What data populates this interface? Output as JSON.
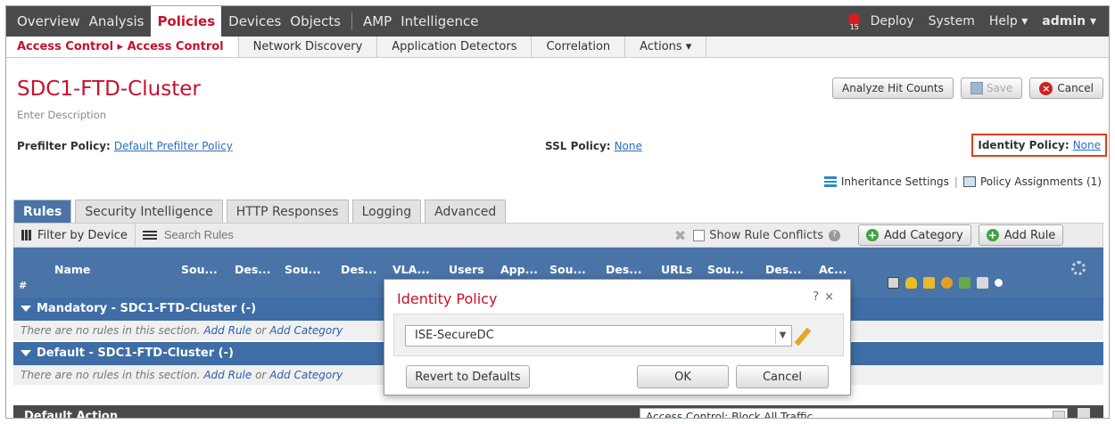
{
  "topnav": {
    "items": [
      "Overview",
      "Analysis",
      "Policies",
      "Devices",
      "Objects",
      "AMP",
      "Intelligence"
    ],
    "active": "Policies",
    "alert_count": "15",
    "right": [
      "Deploy",
      "System",
      "Help ▾",
      "admin ▾"
    ]
  },
  "subnav": {
    "breadcrumb": "Access Control ▸ Access Control",
    "items": [
      "Network Discovery",
      "Application Detectors",
      "Correlation",
      "Actions ▾"
    ]
  },
  "policy": {
    "title": "SDC1-FTD-Cluster",
    "description": "Enter Description",
    "analyze_label": "Analyze Hit Counts",
    "save_label": "Save",
    "cancel_label": "Cancel",
    "prefilter_label": "Prefilter Policy:",
    "prefilter_value": "Default Prefilter Policy",
    "ssl_label": "SSL Policy:",
    "ssl_value": "None",
    "identity_label": "Identity Policy:",
    "identity_value": "None",
    "inheritance_label": "Inheritance Settings",
    "divider": "|",
    "assignments_label": "Policy Assignments (1)"
  },
  "tabs": [
    "Rules",
    "Security Intelligence",
    "HTTP Responses",
    "Logging",
    "Advanced"
  ],
  "toolbar": {
    "filter_device": "Filter by Device",
    "search_placeholder": "Search Rules",
    "show_conflicts": "Show Rule Conflicts",
    "add_category": "Add Category",
    "add_rule": "Add Rule"
  },
  "table": {
    "hash": "#",
    "columns": [
      "Name",
      "Sou...",
      "Des...",
      "Sou...",
      "Des...",
      "VLA...",
      "Users",
      "App...",
      "Sou...",
      "Des...",
      "URLs",
      "Sou...",
      "Des...",
      "Ac..."
    ]
  },
  "sections": [
    {
      "label": "Mandatory - SDC1-FTD-Cluster (-)"
    },
    {
      "label": "Default - SDC1-FTD-Cluster (-)"
    }
  ],
  "norules": {
    "prefix": "There are no rules in this section.",
    "add_rule": "Add Rule",
    "or": "or",
    "add_category": "Add Category"
  },
  "default_action": {
    "label": "Default Action",
    "value": "Access Control: Block All Traffic"
  },
  "modal": {
    "title": "Identity Policy",
    "help": "?",
    "close": "×",
    "selected": "ISE-SecureDC",
    "revert_label": "Revert to Defaults",
    "ok_label": "OK",
    "cancel_label": "Cancel"
  },
  "colors": {
    "accent_red": "#c8102e",
    "header_blue": "#4a74a8",
    "nav_dark": "#4a4a4a",
    "highlight_box": "#e23c1a"
  }
}
